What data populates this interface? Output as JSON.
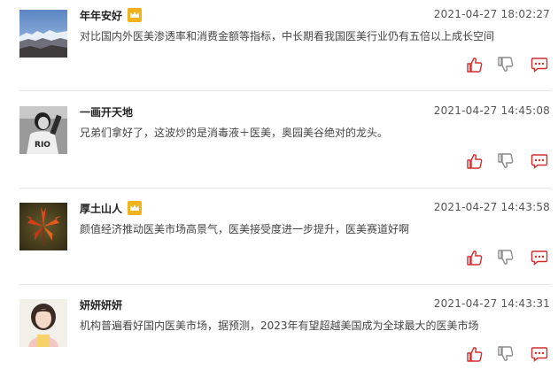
{
  "colors": {
    "accent_red": "#d42b2b",
    "icon_gray": "#8c8c8c",
    "vip_gold": "#f0b21b"
  },
  "comments": [
    {
      "username": "年年安好",
      "vip": true,
      "timestamp": "2021-04-27 18:02:27",
      "text": "对比国内外医美渗透率和消费金额等指标，中长期看我国医美行业仍有五倍以上成长空间",
      "avatar": "mountain-landscape"
    },
    {
      "username": "一画开天地",
      "vip": false,
      "timestamp": "2021-04-27 14:45:08",
      "text": "兄弟们拿好了，这波炒的是消毒液＋医美，奥园美谷绝对的龙头。",
      "avatar": "bw-person-rio-shirt"
    },
    {
      "username": "厚土山人",
      "vip": true,
      "timestamp": "2021-04-27 14:43:58",
      "text": "颜值经济推动医美市场高景气，医美接受度进一步提升，医美赛道好啊",
      "avatar": "red-maple-leaf"
    },
    {
      "username": "妍妍妍妍",
      "vip": false,
      "timestamp": "2021-04-27 14:43:31",
      "text": "机构普遍看好国内医美市场，据预测，2023年有望超越美国成为全球最大的医美市场",
      "avatar": "girl-portrait"
    }
  ]
}
